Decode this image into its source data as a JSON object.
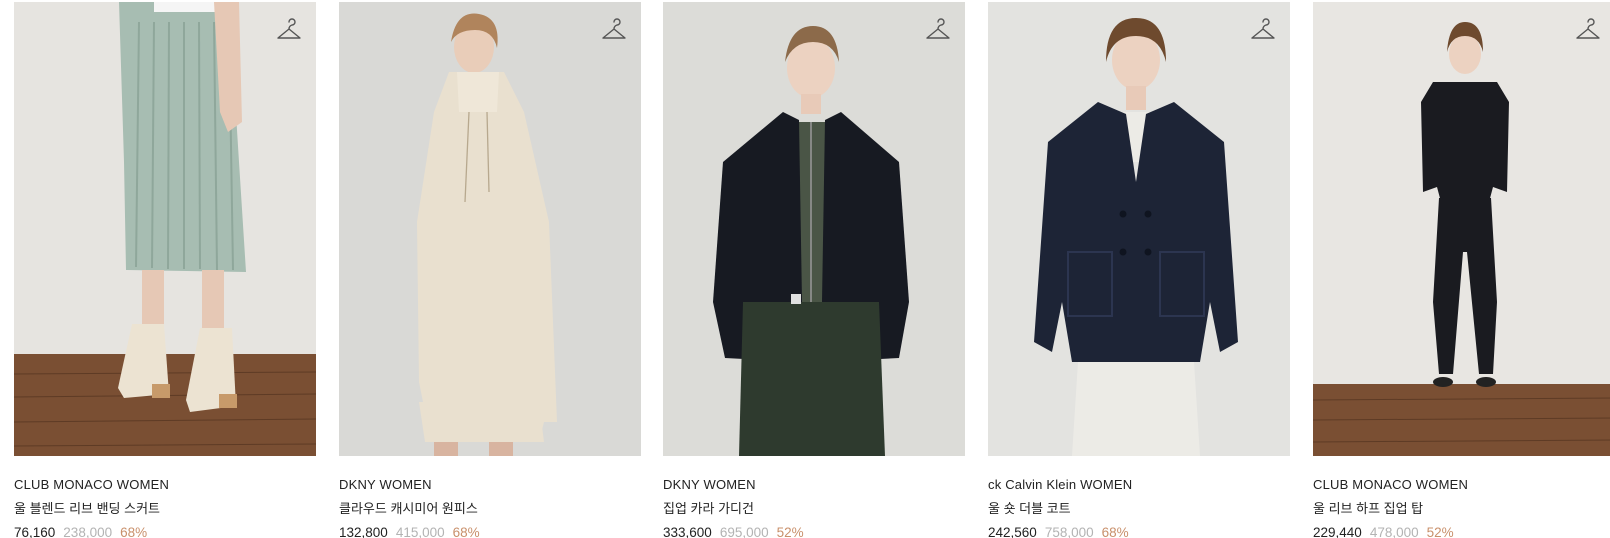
{
  "products": [
    {
      "brand": "CLUB MONACO WOMEN",
      "name": "울 블렌드 리브 밴딩 스커트",
      "sale_price": "76,160",
      "original_price": "238,000",
      "discount": "68%",
      "icon": "hanger-icon",
      "image": {
        "bg": "#e6e4e0",
        "floor": "#7a4f33",
        "garment": "#a7bdb2",
        "garment2": "#ece3d2"
      }
    },
    {
      "brand": "DKNY WOMEN",
      "name": "클라우드 캐시미어 원피스",
      "sale_price": "132,800",
      "original_price": "415,000",
      "discount": "68%",
      "icon": "hanger-icon",
      "image": {
        "bg": "#d9d9d6",
        "floor": "#d9d9d6",
        "garment": "#e9e0cf",
        "garment2": "#e9e0cf"
      }
    },
    {
      "brand": "DKNY WOMEN",
      "name": "집업 카라 가디건",
      "sale_price": "333,600",
      "original_price": "695,000",
      "discount": "52%",
      "icon": "hanger-icon",
      "image": {
        "bg": "#dcdcd8",
        "floor": "#dcdcd8",
        "garment": "#171a22",
        "garment2": "#2e3a2e"
      }
    },
    {
      "brand": "ck Calvin Klein WOMEN",
      "name": "울 숏 더블 코트",
      "sale_price": "242,560",
      "original_price": "758,000",
      "discount": "68%",
      "icon": "hanger-icon",
      "image": {
        "bg": "#e3e3e0",
        "floor": "#e3e3e0",
        "garment": "#1d2436",
        "garment2": "#ecebe6"
      }
    },
    {
      "brand": "CLUB MONACO WOMEN",
      "name": "울 리브 하프 집업 탑",
      "sale_price": "229,440",
      "original_price": "478,000",
      "discount": "52%",
      "icon": "hanger-icon",
      "image": {
        "bg": "#e8e6e2",
        "floor": "#7a4f33",
        "garment": "#1a1b20",
        "garment2": "#1a1b20"
      }
    }
  ]
}
